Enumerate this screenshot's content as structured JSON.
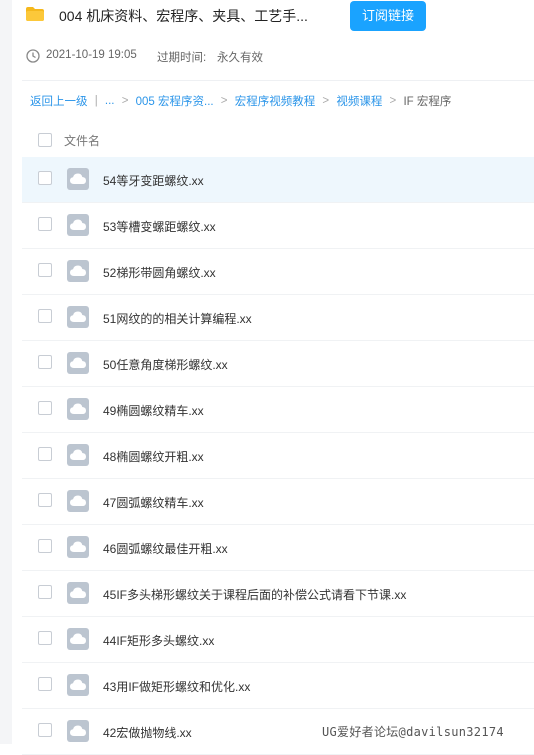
{
  "header": {
    "title": "004 机床资料、宏程序、夹具、工艺手...",
    "subscribe_label": "订阅链接"
  },
  "meta": {
    "date": "2021-10-19 19:05",
    "expire_label": "过期时间:",
    "expire_value": "永久有效"
  },
  "breadcrumb": {
    "back": "返回上一级",
    "sep1": "|",
    "ellipsis": "...",
    "sep": ">",
    "item1": "005 宏程序资...",
    "item2": "宏程序视频教程",
    "item3": "视频课程",
    "current": "IF 宏程序"
  },
  "list_header": {
    "column_name": "文件名"
  },
  "files": [
    "54等牙变距螺纹.xx",
    "53等槽变螺距螺纹.xx",
    "52梯形带圆角螺纹.xx",
    "51网纹的的相关计算编程.xx",
    "50任意角度梯形螺纹.xx",
    "49椭圆螺纹精车.xx",
    "48椭圆螺纹开粗.xx",
    "47圆弧螺纹精车.xx",
    "46圆弧螺纹最佳开粗.xx",
    "45IF多头梯形螺纹关于课程后面的补偿公式请看下节课.xx",
    "44IF矩形多头螺纹.xx",
    "43用IF做矩形螺纹和优化.xx",
    "42宏做抛物线.xx"
  ],
  "watermark": "UG爱好者论坛@davilsun32174",
  "colors": {
    "accent": "#1aa3ff",
    "link": "#2b95e9",
    "selected_row": "#eef7fd",
    "folder": "#f5b81c"
  }
}
